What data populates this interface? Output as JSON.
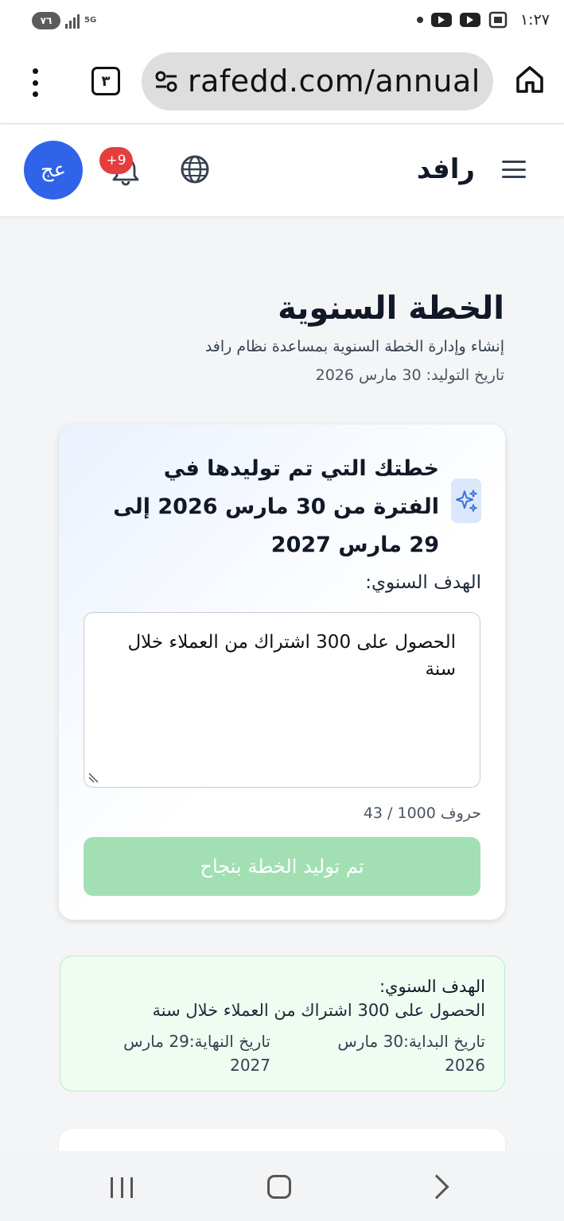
{
  "status_bar": {
    "battery": "٧٦",
    "network": "5G",
    "time": "١:٢٧"
  },
  "browser": {
    "tab_count": "٣",
    "url": "rafedd.com/annual"
  },
  "app_header": {
    "brand": "رافد",
    "avatar_initials": "عج",
    "notification_badge": "+9"
  },
  "page": {
    "title": "الخطة السنوية",
    "subtitle": "إنشاء وإدارة الخطة السنوية بمساعدة نظام رافد",
    "generated_date": "تاريخ التوليد: 30 مارس 2026"
  },
  "plan_card": {
    "title": "خطتك التي تم توليدها في الفترة من 30 مارس 2026 إلى 29 مارس 2027",
    "goal_label": "الهدف السنوي:",
    "goal_value": "الحصول على  300 اشتراك من العملاء خلال سنة",
    "char_count": "43 / 1000 حروف",
    "status_button": "تم توليد الخطة بنجاح"
  },
  "summary_card": {
    "goal_label": "الهدف السنوي:",
    "goal_value": "الحصول على 300 اشتراك من العملاء خلال سنة",
    "start_date": "تاريخ البداية:30 مارس 2026",
    "end_date": "تاريخ النهاية:29 مارس 2027"
  },
  "colors": {
    "accent": "#2f63e8",
    "success_button": "#a2e0b4",
    "badge": "#e53e3e",
    "summary_bg": "#effcf2"
  },
  "icons": [
    "more-vert-icon",
    "tune-icon",
    "home-icon",
    "bell-icon",
    "globe-icon",
    "hamburger-menu-icon",
    "sparkles-icon",
    "resize-handle-icon",
    "youtube-icon"
  ]
}
